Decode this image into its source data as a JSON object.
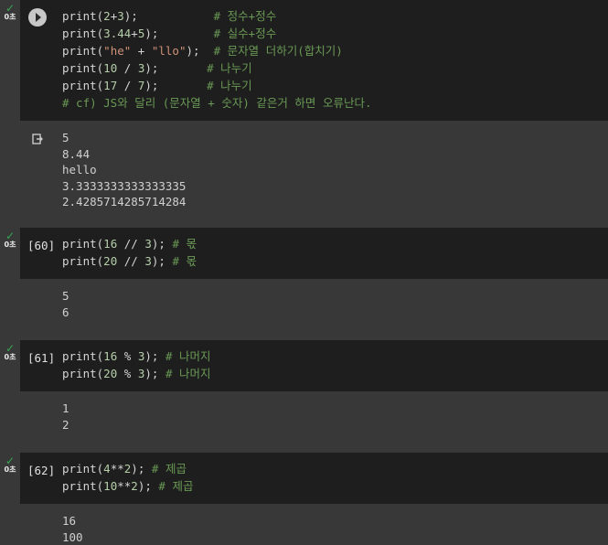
{
  "cells": [
    {
      "time": "0초",
      "exec": "",
      "lines": [
        [
          [
            "k",
            "print"
          ],
          [
            "p",
            "("
          ],
          [
            "n",
            "2"
          ],
          [
            "p",
            "+"
          ],
          [
            "n",
            "3"
          ],
          [
            "p",
            ");"
          ],
          [
            "p",
            "           "
          ],
          [
            "c",
            "# 정수+정수"
          ]
        ],
        [
          [
            "k",
            "print"
          ],
          [
            "p",
            "("
          ],
          [
            "n",
            "3.44"
          ],
          [
            "p",
            "+"
          ],
          [
            "n",
            "5"
          ],
          [
            "p",
            ");"
          ],
          [
            "p",
            "        "
          ],
          [
            "c",
            "# 실수+정수"
          ]
        ],
        [
          [
            "k",
            "print"
          ],
          [
            "p",
            "("
          ],
          [
            "s",
            "\"he\""
          ],
          [
            "p",
            " + "
          ],
          [
            "s",
            "\"llo\""
          ],
          [
            "p",
            ");"
          ],
          [
            "p",
            "  "
          ],
          [
            "c",
            "# 문자열 더하기(합치기)"
          ]
        ],
        [
          [
            "k",
            "print"
          ],
          [
            "p",
            "("
          ],
          [
            "n",
            "10"
          ],
          [
            "p",
            " / "
          ],
          [
            "n",
            "3"
          ],
          [
            "p",
            ");"
          ],
          [
            "p",
            "       "
          ],
          [
            "c",
            "# 나누기"
          ]
        ],
        [
          [
            "k",
            "print"
          ],
          [
            "p",
            "("
          ],
          [
            "n",
            "17"
          ],
          [
            "p",
            " / "
          ],
          [
            "n",
            "7"
          ],
          [
            "p",
            ");"
          ],
          [
            "p",
            "       "
          ],
          [
            "c",
            "# 나누기"
          ]
        ],
        [
          [
            "c",
            "# cf) JS와 달리 (문자열 + 숫자) 같은거 하면 오류난다."
          ]
        ]
      ],
      "output": [
        "5",
        "8.44",
        "hello",
        "3.3333333333333335",
        "2.4285714285714284"
      ]
    },
    {
      "time": "0초",
      "exec": "[60]",
      "lines": [
        [
          [
            "k",
            "print"
          ],
          [
            "p",
            "("
          ],
          [
            "n",
            "16"
          ],
          [
            "p",
            " // "
          ],
          [
            "n",
            "3"
          ],
          [
            "p",
            ");"
          ],
          [
            "p",
            " "
          ],
          [
            "c",
            "# 몫"
          ]
        ],
        [
          [
            "k",
            "print"
          ],
          [
            "p",
            "("
          ],
          [
            "n",
            "20"
          ],
          [
            "p",
            " // "
          ],
          [
            "n",
            "3"
          ],
          [
            "p",
            ");"
          ],
          [
            "p",
            " "
          ],
          [
            "c",
            "# 몫"
          ]
        ]
      ],
      "output": [
        "5",
        "6"
      ]
    },
    {
      "time": "0초",
      "exec": "[61]",
      "lines": [
        [
          [
            "k",
            "print"
          ],
          [
            "p",
            "("
          ],
          [
            "n",
            "16"
          ],
          [
            "p",
            " % "
          ],
          [
            "n",
            "3"
          ],
          [
            "p",
            ");"
          ],
          [
            "p",
            " "
          ],
          [
            "c",
            "# 나머지"
          ]
        ],
        [
          [
            "k",
            "print"
          ],
          [
            "p",
            "("
          ],
          [
            "n",
            "20"
          ],
          [
            "p",
            " % "
          ],
          [
            "n",
            "3"
          ],
          [
            "p",
            ");"
          ],
          [
            "p",
            " "
          ],
          [
            "c",
            "# 나머지"
          ]
        ]
      ],
      "output": [
        "1",
        "2"
      ]
    },
    {
      "time": "0초",
      "exec": "[62]",
      "lines": [
        [
          [
            "k",
            "print"
          ],
          [
            "p",
            "("
          ],
          [
            "n",
            "4"
          ],
          [
            "p",
            "**"
          ],
          [
            "n",
            "2"
          ],
          [
            "p",
            ");"
          ],
          [
            "p",
            " "
          ],
          [
            "c",
            "# 제곱"
          ]
        ],
        [
          [
            "k",
            "print"
          ],
          [
            "p",
            "("
          ],
          [
            "n",
            "10"
          ],
          [
            "p",
            "**"
          ],
          [
            "n",
            "2"
          ],
          [
            "p",
            ");"
          ],
          [
            "p",
            " "
          ],
          [
            "c",
            "# 제곱"
          ]
        ]
      ],
      "output": [
        "16",
        "100"
      ]
    }
  ],
  "icons": {
    "run": "play-icon",
    "status": "check-icon",
    "output": "output-redirect-icon"
  },
  "colors": {
    "editor_bg": "#1e1e1e",
    "page_bg": "#383838",
    "check": "#34a853",
    "comment": "#6a9955",
    "number": "#b5cea8",
    "string": "#ce9178"
  }
}
